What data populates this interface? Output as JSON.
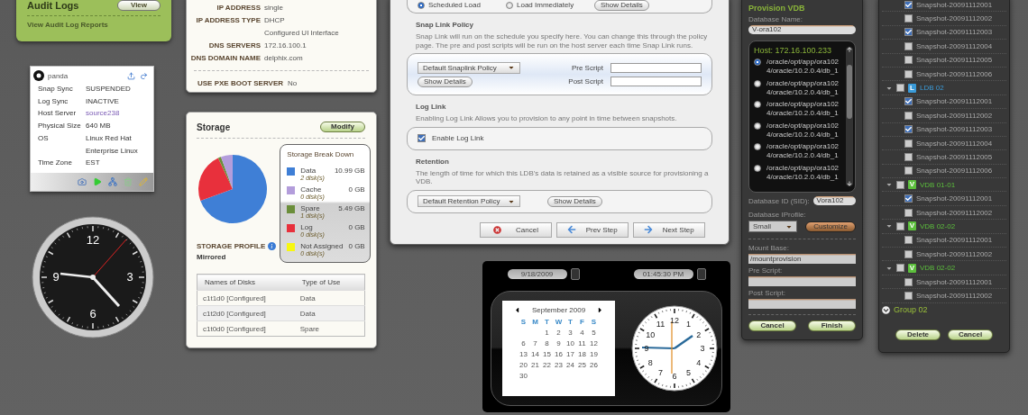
{
  "audit_logs": {
    "title": "Audit Logs",
    "view_button": "View",
    "link": "View Audit Log Reports"
  },
  "host_card": {
    "name": "panda",
    "fields": [
      {
        "label": "Snap Sync",
        "value": "SUSPENDED",
        "kind": "text"
      },
      {
        "label": "Log Sync",
        "value": "INACTIVE",
        "kind": "text"
      },
      {
        "label": "Host Server",
        "value": "source238",
        "kind": "link"
      },
      {
        "label": "Physical Size",
        "value": "640 MB",
        "kind": "text"
      },
      {
        "label": "OS",
        "value": "Linux Red Hat",
        "continuation": "Enterprise Linux",
        "kind": "text"
      },
      {
        "label": "Time Zone",
        "value": "EST",
        "kind": "text"
      }
    ]
  },
  "wall_clock": {
    "numerals": [
      "12",
      "3",
      "6",
      "9"
    ]
  },
  "network": {
    "rows": [
      {
        "label": "IP ADDRESS",
        "value": "single"
      },
      {
        "label": "IP ADDRESS TYPE",
        "value": "DHCP",
        "continuation": "Configured UI Interface"
      },
      {
        "label": "DNS SERVERS",
        "value": "172.16.100.1"
      },
      {
        "label": "DNS DOMAIN NAME",
        "value": "delphix.com"
      }
    ],
    "pxe": {
      "label": "USE PXE BOOT SERVER",
      "value": "No"
    }
  },
  "storage": {
    "title": "Storage",
    "modify_button": "Modify",
    "breakdown_title": "Storage Break Down",
    "legend": [
      {
        "name": "Data",
        "disks": "2 disk(s)",
        "size": "10.99 GB",
        "color": "#3f7fd6"
      },
      {
        "name": "Cache",
        "disks": "0 disk(s)",
        "size": "0 GB",
        "color": "#b39ddb"
      },
      {
        "name": "Spare",
        "disks": "1 disk(s)",
        "size": "5.49 GB",
        "color": "#6b8e3a"
      },
      {
        "name": "Log",
        "disks": "0 disk(s)",
        "size": "0 GB",
        "color": "#e8303c"
      },
      {
        "name": "Not Assigned",
        "disks": "0 disk(s)",
        "size": "0 GB",
        "color": "#f7f70f"
      }
    ],
    "profile_label": "STORAGE PROFILE",
    "profile_value": "Mirrored",
    "table": {
      "columns": [
        "Names of Disks",
        "Type of Use"
      ],
      "rows": [
        [
          "c1t1d0 [Configured]",
          "Data"
        ],
        [
          "c1t2d0 [Configured]",
          "Data"
        ],
        [
          "c1t0d0 [Configured]",
          "Spare"
        ]
      ]
    }
  },
  "wizard": {
    "load_options": [
      {
        "label": "Scheduled Load",
        "selected": true
      },
      {
        "label": "Load Immediately",
        "selected": false
      }
    ],
    "load_details_button": "Show Details",
    "snap_link": {
      "heading": "Snap Link Policy",
      "description": "Snap Link will run on the schedule you specify here. You can change this through the policy page. The pre and post scripts will be run on the host server each time Snap Link runs.",
      "policy": "Default Snaplink Policy",
      "details_button": "Show Details",
      "pre_script_label": "Pre Script",
      "post_script_label": "Post Script"
    },
    "log_link": {
      "heading": "Log Link",
      "description": "Enabling Log Link Allows you to provision to any point in time between snapshots.",
      "checkbox": {
        "label": "Enable Log Link",
        "checked": true
      }
    },
    "retention": {
      "heading": "Retention",
      "description": "The length of time for which this LDB's data is retained as a visible source  for provisioning a VDB.",
      "policy": "Default Retention Policy",
      "details_button": "Show Details"
    },
    "buttons": [
      {
        "kind": "cancel",
        "label": "Cancel"
      },
      {
        "kind": "prev",
        "label": "Prev Step"
      },
      {
        "kind": "next",
        "label": "Next Step"
      }
    ]
  },
  "datetime": {
    "date": "9/18/2009",
    "time": "01:45:30 PM",
    "calendar": {
      "month": "September 2009",
      "weekdays": [
        "S",
        "M",
        "T",
        "W",
        "T",
        "F",
        "S"
      ],
      "weeks": [
        [
          "1",
          "2",
          "3",
          "4",
          "5"
        ],
        [
          "6",
          "7",
          "8",
          "9",
          "10",
          "11",
          "12"
        ],
        [
          "13",
          "14",
          "15",
          "16",
          "17",
          "18",
          "19"
        ],
        [
          "20",
          "21",
          "22",
          "23",
          "24",
          "25",
          "26"
        ],
        [
          "30"
        ]
      ]
    },
    "clock_numerals": [
      "1",
      "2",
      "3",
      "4",
      "5",
      "6",
      "7",
      "8",
      "9",
      "10",
      "11",
      "12"
    ]
  },
  "provision": {
    "title": "Provision VDB",
    "db_name_label": "Database Name:",
    "db_name": "V-ora102",
    "host": "Host: 172.16.100.233",
    "homes": [
      {
        "path": "/oracle/opt/app/ora1024/oracle/10.2.0.4/db_1",
        "selected": true
      },
      {
        "path": "/oracle/opt/app/ora1024/oracle/10.2.0.4/db_1",
        "selected": false
      },
      {
        "path": "/oracle/opt/app/ora1024/oracle/10.2.0.4/db_1",
        "selected": false
      },
      {
        "path": "/oracle/opt/app/ora1024/oracle/10.2.0.4/db_1",
        "selected": false
      },
      {
        "path": "/oracle/opt/app/ora1024/oracle/10.2.0.4/db_1",
        "selected": false
      },
      {
        "path": "/oracle/opt/app/ora1024/oracle/10.2.0.4/db_1",
        "selected": false
      }
    ],
    "sid_label": "Database ID (SID):",
    "sid": "Vora102",
    "profile_label": "Database IProfile:",
    "profile": "Small",
    "customize_button": "Customize",
    "mount_label": "Mount Base:",
    "mount": "/mountprovision",
    "pre_script_label": "Pre Script:",
    "post_script_label": "Post Script:",
    "buttons": [
      "Cancel",
      "Finish"
    ]
  },
  "tree": {
    "top_snapshots": [
      {
        "label": "Snapshot-20091112001",
        "checked": true
      },
      {
        "label": "Snapshot-20091112002",
        "checked": false
      },
      {
        "label": "Snapshot-20091112003",
        "checked": true
      },
      {
        "label": "Snapshot-20091112004",
        "checked": false
      },
      {
        "label": "Snapshot-20091112005",
        "checked": false
      },
      {
        "label": "Snapshot-20091112006",
        "checked": false
      }
    ],
    "nodes": [
      {
        "kind": "ldb",
        "badge": "L",
        "label": "LDB 02",
        "checked": false,
        "expanded": true,
        "children": [
          {
            "label": "Snapshot-20091112001",
            "checked": true
          },
          {
            "label": "Snapshot-20091112002",
            "checked": false
          },
          {
            "label": "Snapshot-20091112003",
            "checked": true
          },
          {
            "label": "Snapshot-20091112004",
            "checked": false
          },
          {
            "label": "Snapshot-20091112005",
            "checked": false
          },
          {
            "label": "Snapshot-20091112006",
            "checked": false
          }
        ]
      },
      {
        "kind": "vdb",
        "badge": "V",
        "label": "VDB 01-01",
        "checked": false,
        "expanded": true,
        "children": [
          {
            "label": "Snapshot-20091112001",
            "checked": true
          },
          {
            "label": "Snapshot-20091112002",
            "checked": false
          }
        ]
      },
      {
        "kind": "vdb",
        "badge": "V",
        "label": "VDB 02-02",
        "checked": false,
        "expanded": true,
        "children": [
          {
            "label": "Snapshot-20091112001",
            "checked": false
          },
          {
            "label": "Snapshot-20091112002",
            "checked": false
          }
        ]
      },
      {
        "kind": "vdb",
        "badge": "V",
        "label": "VDB 02-02",
        "checked": false,
        "expanded": true,
        "children": [
          {
            "label": "Snapshot-20091112001",
            "checked": false
          },
          {
            "label": "Snapshot-20091112002",
            "checked": false
          }
        ]
      },
      {
        "kind": "group",
        "label": "Group 02",
        "expanded": false
      }
    ],
    "buttons": [
      "Delete",
      "Cancel"
    ]
  }
}
